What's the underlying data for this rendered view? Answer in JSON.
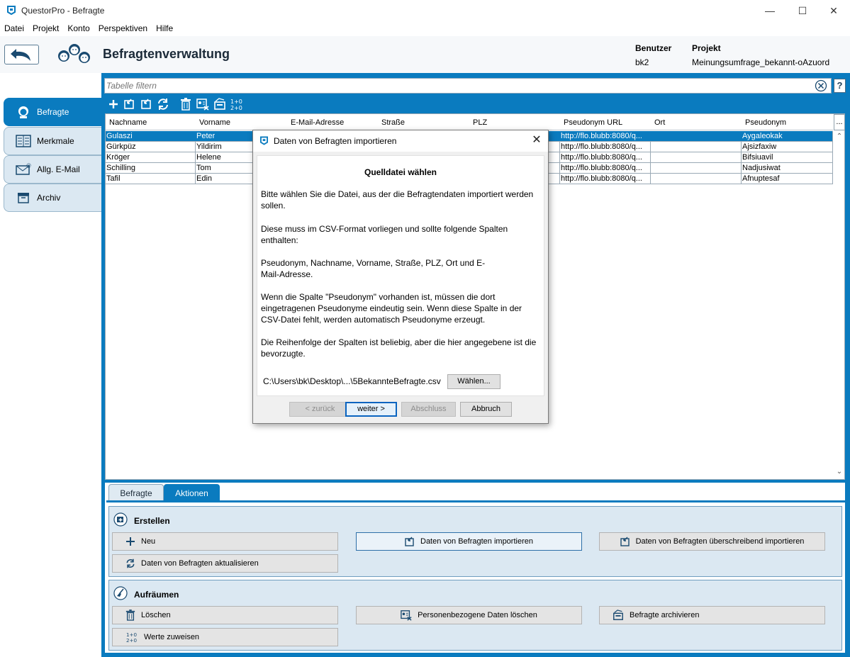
{
  "window": {
    "title": "QuestorPro - Befragte",
    "controls": {
      "minimize": "—",
      "maximize": "☐",
      "close": "✕"
    }
  },
  "menu": [
    "Datei",
    "Projekt",
    "Konto",
    "Perspektiven",
    "Hilfe"
  ],
  "header": {
    "title": "Befragtenverwaltung",
    "user_label": "Benutzer",
    "user_value": "bk2",
    "project_label": "Projekt",
    "project_value": "Meinungsumfrage_bekannt-oAzuord"
  },
  "sidebar": {
    "items": [
      {
        "label": "Befragte",
        "icon": "person-icon",
        "active": true
      },
      {
        "label": "Merkmale",
        "icon": "list-icon",
        "active": false
      },
      {
        "label": "Allg. E-Mail",
        "icon": "mail-icon",
        "active": false
      },
      {
        "label": "Archiv",
        "icon": "archive-icon",
        "active": false
      }
    ]
  },
  "filter": {
    "placeholder": "Tabelle filtern",
    "help": "?"
  },
  "table": {
    "columns": [
      "Nachname",
      "Vorname",
      "E-Mail-Adresse",
      "Straße",
      "PLZ",
      "Pseudonym URL",
      "Ort",
      "Pseudonym"
    ],
    "more": "...",
    "rows": [
      {
        "nachname": "Gulaszi",
        "vorname": "Peter",
        "url": "http://flo.blubb:8080/q...",
        "pseudonym": "Aygaleokak",
        "selected": true
      },
      {
        "nachname": "Gürkpüz",
        "vorname": "Yildirim",
        "url": "http://flo.blubb:8080/q...",
        "pseudonym": "Ajsizfaxiw",
        "selected": false
      },
      {
        "nachname": "Kröger",
        "vorname": "Helene",
        "url": "http://flo.blubb:8080/q...",
        "pseudonym": "Bifsiuavil",
        "selected": false
      },
      {
        "nachname": "Schilling",
        "vorname": "Tom",
        "url": "http://flo.blubb:8080/q...",
        "pseudonym": "Nadjusiwat",
        "selected": false
      },
      {
        "nachname": "Tafil",
        "vorname": "Edin",
        "url": "http://flo.blubb:8080/q...",
        "pseudonym": "Afnuptesaf",
        "selected": false
      }
    ]
  },
  "bottom_tabs": {
    "befragte": "Befragte",
    "aktionen": "Aktionen"
  },
  "erstellen": {
    "title": "Erstellen",
    "neu": "Neu",
    "importieren": "Daten von Befragten importieren",
    "ueberschreibend": "Daten von Befragten überschreibend importieren",
    "aktualisieren": "Daten von Befragten aktualisieren"
  },
  "aufraeumen": {
    "title": "Aufräumen",
    "loeschen": "Löschen",
    "personendaten": "Personenbezogene Daten löschen",
    "archivieren": "Befragte archivieren",
    "werte": "Werte zuweisen"
  },
  "dialog": {
    "title": "Daten von Befragten importieren",
    "heading": "Quelldatei wählen",
    "p1": "Bitte wählen Sie die Datei, aus der die Befragtendaten importiert werden sollen.",
    "p2": "Diese muss im CSV-Format vorliegen und sollte folgende Spalten enthalten:",
    "p3": "Pseudonym, Nachname, Vorname, Straße, PLZ, Ort und E-Mail-Adresse.",
    "p4": "Wenn die Spalte \"Pseudonym\" vorhanden ist, müssen die dort eingetragenen Pseudonyme eindeutig sein. Wenn diese Spalte in der CSV-Datei fehlt, werden automatisch Pseudonyme erzeugt.",
    "p5": "Die Reihenfolge der Spalten ist beliebig, aber die hier angegebene ist die bevorzugte.",
    "file_path": "C:\\Users\\bk\\Desktop\\...\\5BekannteBefragte.csv",
    "choose": "Wählen...",
    "back": "< zurück",
    "next": "weiter >",
    "finish": "Abschluss",
    "cancel": "Abbruch"
  }
}
